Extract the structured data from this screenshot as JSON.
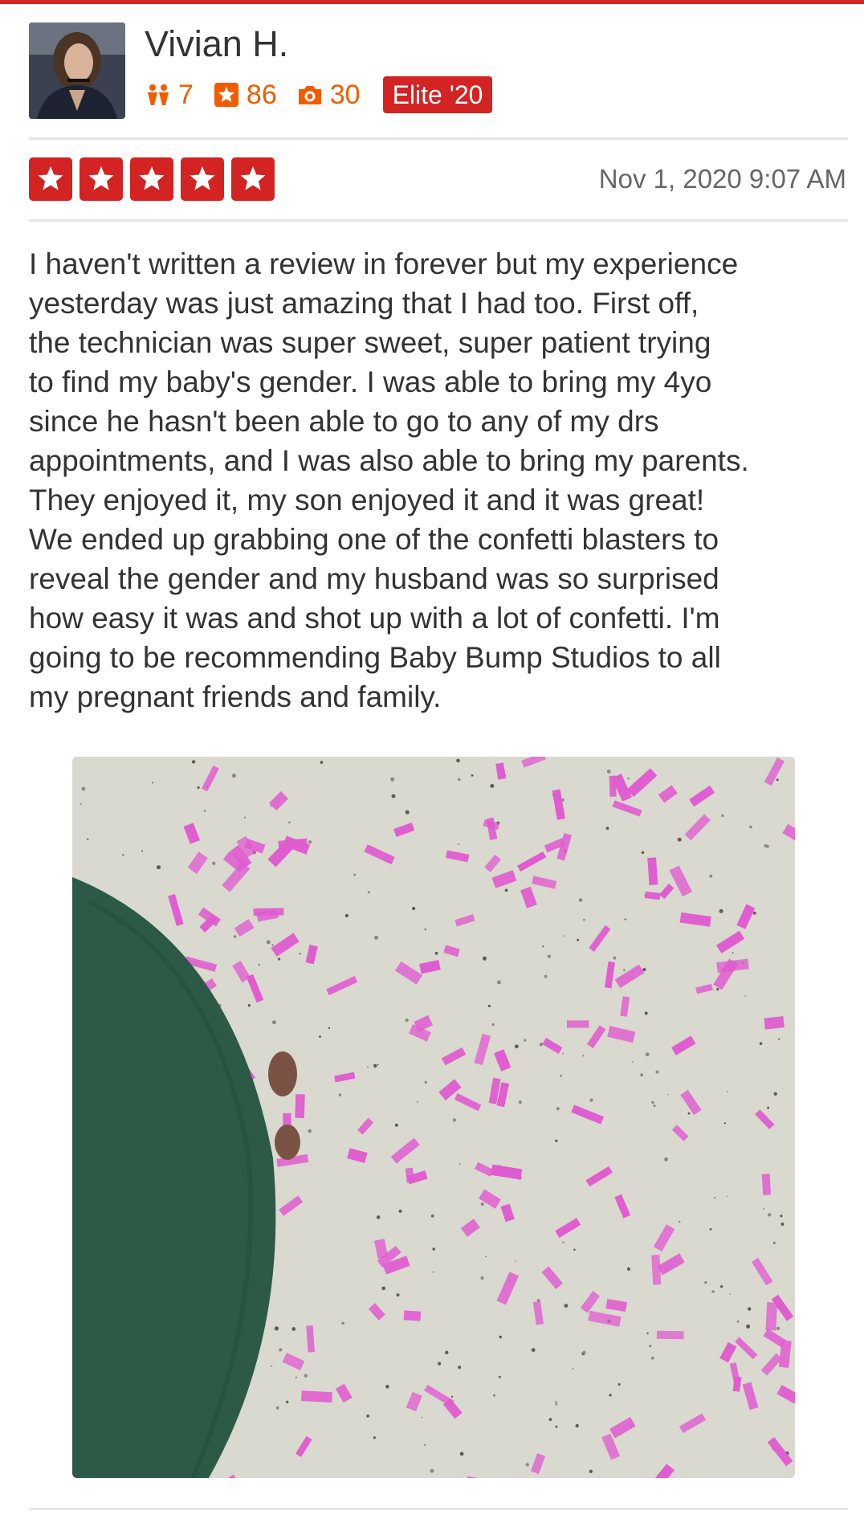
{
  "user": {
    "name": "Vivian H.",
    "friends_count": "7",
    "reviews_count": "86",
    "photos_count": "30",
    "elite_label": "Elite '20"
  },
  "review": {
    "rating": 5,
    "date": "Nov 1, 2020 9:07 AM",
    "text": "I haven't written a review in forever but my experience\nyesterday was just amazing that I had too. First off,\nthe technician was super sweet, super patient trying\nto find my baby's gender. I was able to bring my 4yo\nsince he hasn't been able to go to any of my drs\nappointments, and I was also able to bring my parents.\nThey enjoyed it, my son enjoyed it and it was great!\nWe ended up grabbing one of the confetti blasters to\nreveal the gender and my husband was so surprised\nhow easy it was and shot up with a lot of confetti. I'm\ngoing to be recommending Baby Bump Studios to all\nmy pregnant friends and family."
  },
  "icons": {
    "friends": "friends-icon",
    "reviews": "review-star-icon",
    "photos": "camera-icon",
    "rating": "star-icon"
  },
  "colors": {
    "brand_red": "#d32323",
    "stat_orange": "#f15c00",
    "confetti_pink": "#e05ad0",
    "dress_green": "#2d5a47"
  }
}
